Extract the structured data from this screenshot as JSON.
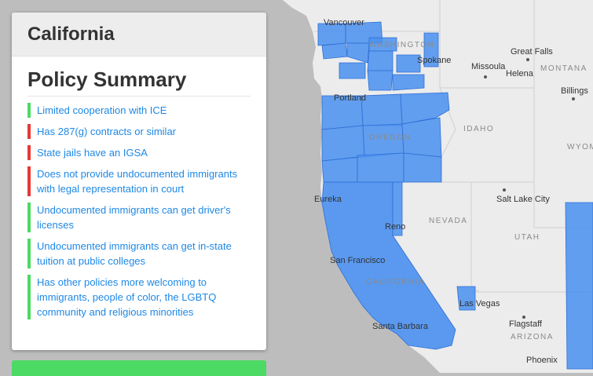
{
  "panel": {
    "state_name": "California",
    "summary_title": "Policy Summary",
    "policies": [
      {
        "text": "Limited cooperation with ICE",
        "status": "green"
      },
      {
        "text": "Has 287(g) contracts or similar",
        "status": "red"
      },
      {
        "text": "State jails have an IGSA",
        "status": "red"
      },
      {
        "text": "Does not provide undocumented immigrants with legal representation in court",
        "status": "red"
      },
      {
        "text": "Undocumented immigrants can get driver's licenses",
        "status": "green"
      },
      {
        "text": "Undocumented immigrants can get in-state tuition at public colleges",
        "status": "green"
      },
      {
        "text": "Has other policies more welcoming to immigrants, people of color, the LGBTQ community and religious minorities",
        "status": "green"
      }
    ]
  },
  "colors": {
    "green": "#4cd964",
    "red": "#e53935",
    "highlight": "#4a90f0"
  },
  "map": {
    "cities": {
      "vancouver": "Vancouver",
      "spokane": "Spokane",
      "missoula": "Missoula",
      "great_falls": "Great Falls",
      "helena": "Helena",
      "billings": "Billings",
      "portland": "Portland",
      "eureka": "Eureka",
      "reno": "Reno",
      "salt_lake_city": "Salt Lake City",
      "san_francisco": "San Francisco",
      "las_vegas": "Las Vegas",
      "santa_barbara": "Santa Barbara",
      "flagstaff": "Flagstaff",
      "phoenix": "Phoenix"
    },
    "states": {
      "washington": "WASHINGTON",
      "montana": "MONTANA",
      "oregon": "OREGON",
      "idaho": "IDAHO",
      "wyoming": "WYOM",
      "nevada": "NEVADA",
      "utah": "UTAH",
      "california": "CALIFORNIA",
      "arizona": "ARIZONA"
    }
  }
}
